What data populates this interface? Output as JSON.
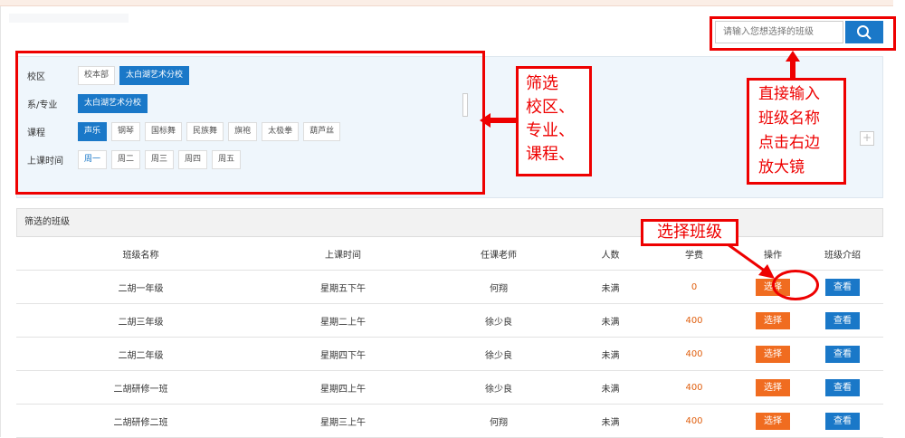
{
  "search": {
    "placeholder": "请输入您想选择的班级"
  },
  "filters": {
    "campus": {
      "label": "校区",
      "options": [
        "校本部",
        "太白湖艺术分校"
      ],
      "selected": "太白湖艺术分校"
    },
    "department": {
      "label": "系/专业",
      "options": [
        "太白湖艺术分校"
      ],
      "selected": "太白湖艺术分校"
    },
    "course": {
      "label": "课程",
      "options": [
        "声乐",
        "钢琴",
        "国标舞",
        "民族舞",
        "旗袍",
        "太极拳",
        "葫芦丝"
      ],
      "selected": "声乐"
    },
    "time": {
      "label": "上课时间",
      "options": [
        "周一",
        "周二",
        "周三",
        "周四",
        "周五"
      ],
      "selected": "周一"
    }
  },
  "annotations": {
    "filter_note": [
      "筛选",
      "校区、",
      "专业、",
      "课程、"
    ],
    "search_note": [
      "直接输入",
      "班级名称",
      "点击右边",
      "放大镜"
    ],
    "select_note": "选择班级"
  },
  "section": {
    "title": "筛选的班级"
  },
  "table": {
    "headers": [
      "班级名称",
      "上课时间",
      "任课老师",
      "人数",
      "学费",
      "操作",
      "班级介绍"
    ],
    "rows": [
      {
        "name": "二胡一年级",
        "time": "星期五下午",
        "teacher": "何翔",
        "count": "未满",
        "fee": "0",
        "action": "选择",
        "intro": "查看"
      },
      {
        "name": "二胡三年级",
        "time": "星期二上午",
        "teacher": "徐少良",
        "count": "未满",
        "fee": "400",
        "action": "选择",
        "intro": "查看"
      },
      {
        "name": "二胡二年级",
        "time": "星期四下午",
        "teacher": "徐少良",
        "count": "未满",
        "fee": "400",
        "action": "选择",
        "intro": "查看"
      },
      {
        "name": "二胡研修一班",
        "time": "星期四上午",
        "teacher": "徐少良",
        "count": "未满",
        "fee": "400",
        "action": "选择",
        "intro": "查看"
      },
      {
        "name": "二胡研修二班",
        "time": "星期三上午",
        "teacher": "何翔",
        "count": "未满",
        "fee": "400",
        "action": "选择",
        "intro": "查看"
      }
    ]
  },
  "colors": {
    "accent": "#1a78c8",
    "select": "#f06c20",
    "annotation": "#e00000"
  }
}
